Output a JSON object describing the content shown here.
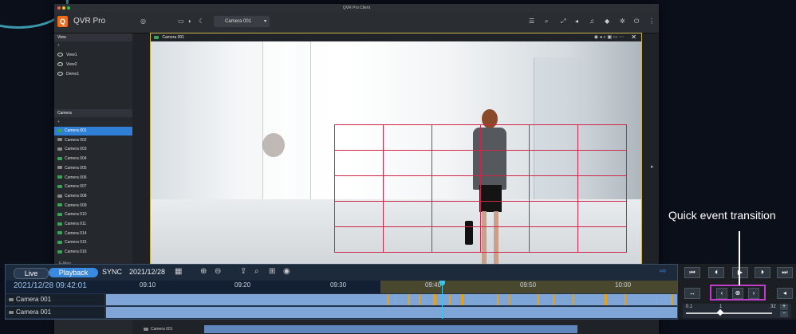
{
  "window": {
    "title": "QVR Pro Client"
  },
  "app": {
    "name": "QVR Pro",
    "logo": "Q",
    "camera_select": "Camera 001"
  },
  "sidebar": {
    "view_section": "View",
    "views": [
      "View1",
      "View2",
      "Demo1"
    ],
    "camera_section": "Camera",
    "cameras": [
      "Camera 001",
      "Camera 002",
      "Camera 003",
      "Camera 004",
      "Camera 005",
      "Camera 006",
      "Camera 007",
      "Camera 008",
      "Camera 009",
      "Camera 010",
      "Camera 011",
      "Camera 014",
      "Camera 015",
      "Camera 016"
    ],
    "emap_label": "E-Map"
  },
  "viewport": {
    "camera_title": "Camera 001"
  },
  "timeline": {
    "live_label": "Live",
    "playback_label": "Playback",
    "sync_label": "SYNC",
    "date": "2021/12/28",
    "current_time": "2021/12/28 09:42:01",
    "ticks": [
      "09:10",
      "09:20",
      "09:30",
      "09:40",
      "09:50",
      "10:00"
    ],
    "tracks": [
      "Camera 001",
      "Camera 001"
    ],
    "bottom_label": "Camera 001"
  },
  "speed": {
    "min": "0.1",
    "mid": "1",
    "max": "32"
  },
  "callout": "Quick event transition",
  "colors": {
    "accent": "#2f7fd6",
    "event": "#e6a11c",
    "highlight": "#c03dc8",
    "motion_grid": "#d0264a"
  }
}
